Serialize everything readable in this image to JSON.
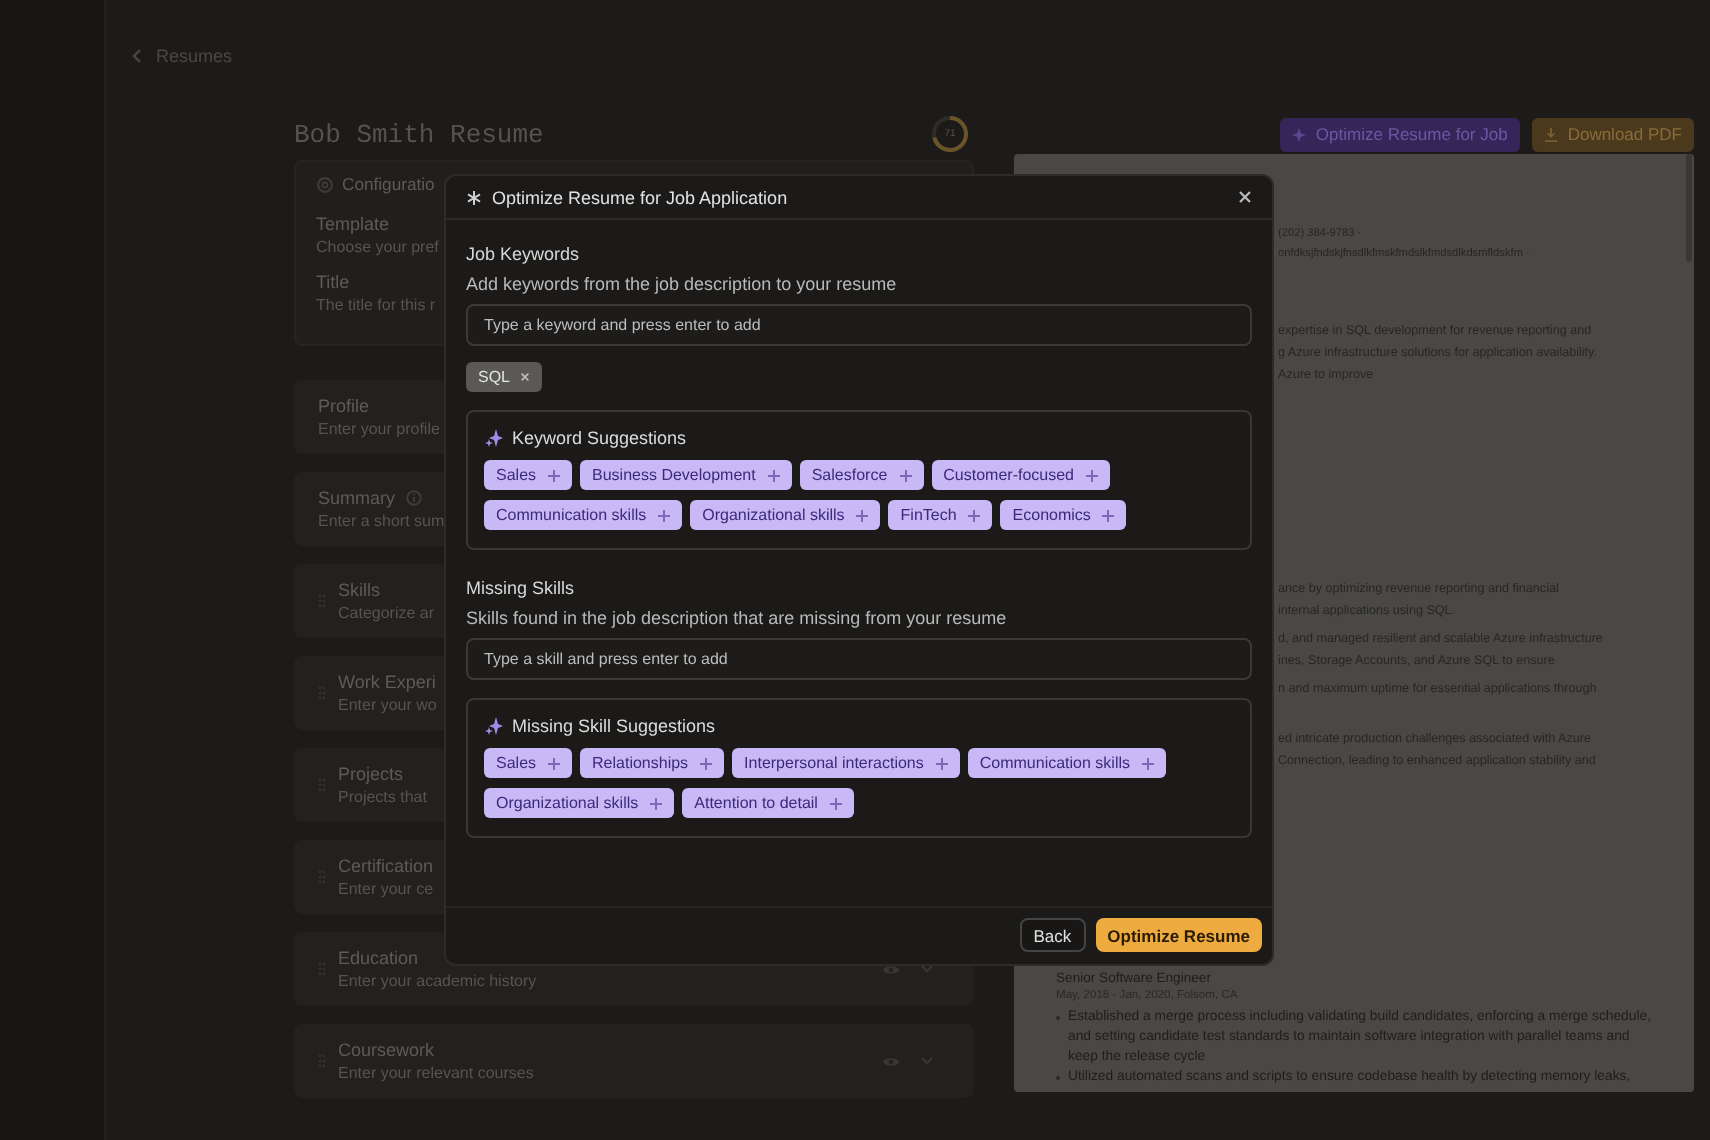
{
  "breadcrumb": {
    "label": "Resumes"
  },
  "resume_title": "Bob Smith Resume",
  "score": {
    "value": "71",
    "level": 0.71
  },
  "actions": [
    {
      "label": "Optimize Resume for Job",
      "kind": "optimize"
    },
    {
      "label": "Download PDF",
      "kind": "download"
    }
  ],
  "sections": [
    {
      "title": "Configuratio",
      "kind": "config",
      "fields": [
        {
          "label": "Template",
          "hint": "Choose your pref"
        },
        {
          "label": "Title",
          "hint": "The title for this r"
        }
      ]
    },
    {
      "title": "Profile",
      "hint": "Enter your profile",
      "kind": "plain"
    },
    {
      "title": "Summary",
      "hint": "Enter a short sum",
      "kind": "info"
    },
    {
      "title": "Skills",
      "hint": "Categorize ar",
      "kind": "drag"
    },
    {
      "title": "Work Experi",
      "hint": "Enter your wo",
      "kind": "drag"
    },
    {
      "title": "Projects",
      "hint": "Projects that",
      "kind": "drag"
    },
    {
      "title": "Certification",
      "hint": "Enter your ce",
      "kind": "drag"
    },
    {
      "title": "Education",
      "hint": "Enter your academic history",
      "kind": "drag_actions"
    },
    {
      "title": "Coursework",
      "hint": "Enter your relevant courses",
      "kind": "drag_actions"
    }
  ],
  "preview": {
    "contact_lines": [
      "(202) 384-9783 ·",
      "onfdksjfndskjfnsdlkfmskfmdslkfmdsdlkdsmfldskfm ·"
    ],
    "summary_lines": [
      "expertise in SQL development for revenue reporting and",
      "g Azure infrastructure solutions for application availability.",
      "Azure to improve"
    ],
    "fragments": [
      [
        "ance by optimizing revenue reporting and financial",
        "internal applications using SQL."
      ],
      [
        "d, and managed resilient and scalable Azure infrastructure",
        "ines, Storage Accounts, and Azure SQL to ensure"
      ],
      [
        "n and maximum uptime for essential applications through"
      ],
      [
        "ed intricate production challenges associated with Azure",
        "Connection, leading to enhanced application stability and"
      ]
    ],
    "job_title": "Senior Software Engineer",
    "job_meta": "May, 2018 - Jan, 2020, Folsom, CA",
    "bullets": [
      "Established a merge process including validating build candidates, enforcing a merge schedule, and setting candidate test standards to maintain software integration with parallel teams and keep the release cycle",
      "Utilized automated scans and scripts to ensure codebase health by detecting memory leaks,"
    ]
  },
  "dialog": {
    "title": "Optimize Resume for Job Application",
    "keywords": {
      "heading": "Job Keywords",
      "description": "Add keywords from the job description to your resume",
      "placeholder": "Type a keyword and press enter to add",
      "added": [
        "SQL"
      ],
      "suggestions": {
        "title": "Keyword Suggestions",
        "items": [
          "Sales",
          "Business Development",
          "Salesforce",
          "Customer-focused",
          "Communication skills",
          "Organizational skills",
          "FinTech",
          "Economics"
        ]
      }
    },
    "missing": {
      "heading": "Missing Skills",
      "description": "Skills found in the job description that are missing from your resume",
      "placeholder": "Type a skill and press enter to add",
      "suggestions": {
        "title": "Missing Skill Suggestions",
        "items": [
          "Sales",
          "Relationships",
          "Interpersonal interactions",
          "Communication skills",
          "Organizational skills",
          "Attention to detail"
        ]
      }
    },
    "buttons": [
      {
        "label": "Back",
        "kind": "secondary"
      },
      {
        "label": "Optimize Resume",
        "kind": "primary"
      }
    ]
  }
}
